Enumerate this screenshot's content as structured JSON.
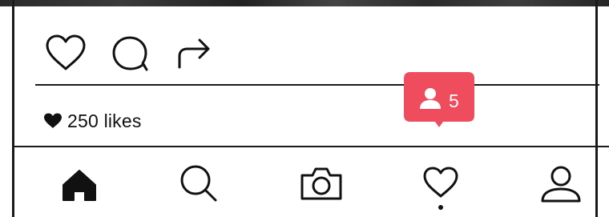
{
  "post": {
    "likes_text": "250 likes"
  },
  "notification_badge": {
    "count": "5",
    "color": "#ef4c5d"
  },
  "icons": {
    "actions": [
      "heart-icon",
      "comment-icon",
      "share-icon"
    ],
    "likes": "heart-filled-icon",
    "badge": "person-icon",
    "bottom_nav": [
      "home-icon",
      "search-icon",
      "camera-icon",
      "heart-icon",
      "profile-icon"
    ]
  },
  "bottom_nav": {
    "active_tab": "activity"
  }
}
